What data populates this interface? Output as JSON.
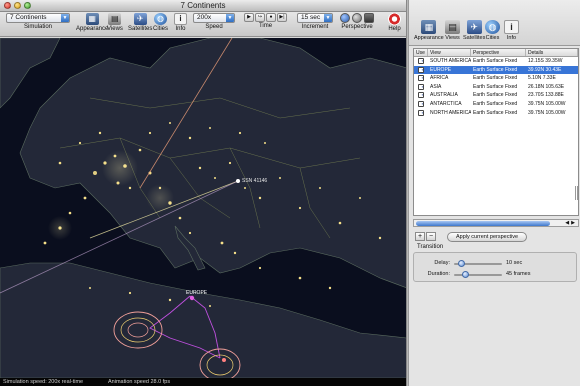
{
  "window": {
    "title": "7 Continents"
  },
  "toolbar": {
    "simulation": {
      "value": "7 Continents",
      "label": "Simulation"
    },
    "appearance_label": "Appearance",
    "views_label": "Views",
    "satellites_label": "Satellites",
    "cities_label": "Cities",
    "info_label": "Info",
    "speed": {
      "value": "200x",
      "label": "Speed"
    },
    "time_label": "Time",
    "increment": {
      "value": "15 sec",
      "label": "Increment"
    },
    "perspective_label": "Perspective",
    "help_label": "Help"
  },
  "map": {
    "sat_label_1": "SSN 41146",
    "sat_label_2": "EUROPE"
  },
  "status": {
    "simulation_speed": "Simulation speed: 200x real-time",
    "animation_speed": "Animation speed 28.0 fps"
  },
  "side": {
    "toolbar": {
      "appearance_label": "Appearance",
      "views_label": "Views",
      "satellites_label": "Satellites",
      "cities_label": "Cities",
      "info_label": "Info"
    },
    "table": {
      "columns": [
        "Use",
        "View",
        "Perspective",
        "Details"
      ],
      "rows": [
        {
          "view": "SOUTH AMERICA",
          "perspective": "Earth Surface Fixed",
          "details": "12.15S 39.35W",
          "selected": false
        },
        {
          "view": "EUROPE",
          "perspective": "Earth Surface Fixed",
          "details": "39.92N 30.43E",
          "selected": true
        },
        {
          "view": "AFRICA",
          "perspective": "Earth Surface Fixed",
          "details": "5.10N 7.33E",
          "selected": false
        },
        {
          "view": "ASIA",
          "perspective": "Earth Surface Fixed",
          "details": "26.18N 105.63E",
          "selected": false
        },
        {
          "view": "AUSTRALIA",
          "perspective": "Earth Surface Fixed",
          "details": "23.70S 133.88E",
          "selected": false
        },
        {
          "view": "ANTARCTICA",
          "perspective": "Earth Surface Fixed",
          "details": "39.75N 105.00W",
          "selected": false
        },
        {
          "view": "NORTH AMERICA",
          "perspective": "Earth Surface Fixed",
          "details": "39.75N 105.00W",
          "selected": false
        }
      ]
    },
    "add_label": "+",
    "remove_label": "−",
    "apply_label": "Apply current perspective",
    "transition": {
      "header": "Transition",
      "delay_label": "Delay:",
      "delay_value": "10 sec",
      "delay_fraction": 0.1,
      "duration_label": "Duration:",
      "duration_value": "45 frames",
      "duration_fraction": 0.2
    }
  },
  "colors": {
    "selection": "#3875d7",
    "map_ocean": "#0a0e1e",
    "land": "#232838",
    "city_lights": "#f6e08a",
    "orbit_ring": "#f2a09a",
    "ground_track": "#c050e0"
  }
}
